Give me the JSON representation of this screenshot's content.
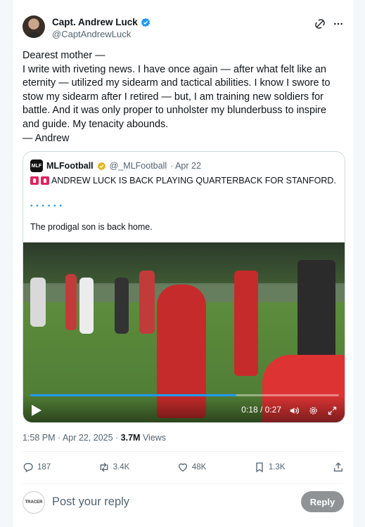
{
  "tweet": {
    "display_name": "Capt. Andrew Luck",
    "handle": "@CaptAndrewLuck",
    "text": "Dearest mother —\nI write with riveting news. I have once again — after what felt like an eternity — utilized my sidearm and tactical abilities. I know I swore to stow my sidearm after I retired — but, I am training new soldiers for battle. And it was only proper to unholster my blunderbuss to inspire and guide. My tenacity abounds.\n— Andrew",
    "timestamp": "1:58 PM · Apr 22, 2025 · ",
    "views_count": "3.7M",
    "views_label": " Views"
  },
  "quote": {
    "avatar_text": "MLF",
    "display_name": "MLFootball",
    "handle": "@_MLFootball",
    "date": "· Apr 22",
    "line1": "ANDREW LUCK IS BACK PLAYING QUARTERBACK FOR STANFORD.",
    "dots": "• • • • • •",
    "line2": "The prodigal son is back home.",
    "video": {
      "time": "0:18 / 0:27",
      "progress": 0.667
    }
  },
  "actions": {
    "replies": "187",
    "reposts": "3.4K",
    "likes": "48K",
    "bookmarks": "1.3K"
  },
  "reply": {
    "avatar_text": "TRACER",
    "placeholder": "Post your reply",
    "button": "Reply"
  },
  "colors": {
    "accent": "#1d9bf0",
    "verified": "#1d9bf0",
    "badge_gold": "#e2b719",
    "muted": "#536471",
    "reply_button": "#8f9396"
  }
}
